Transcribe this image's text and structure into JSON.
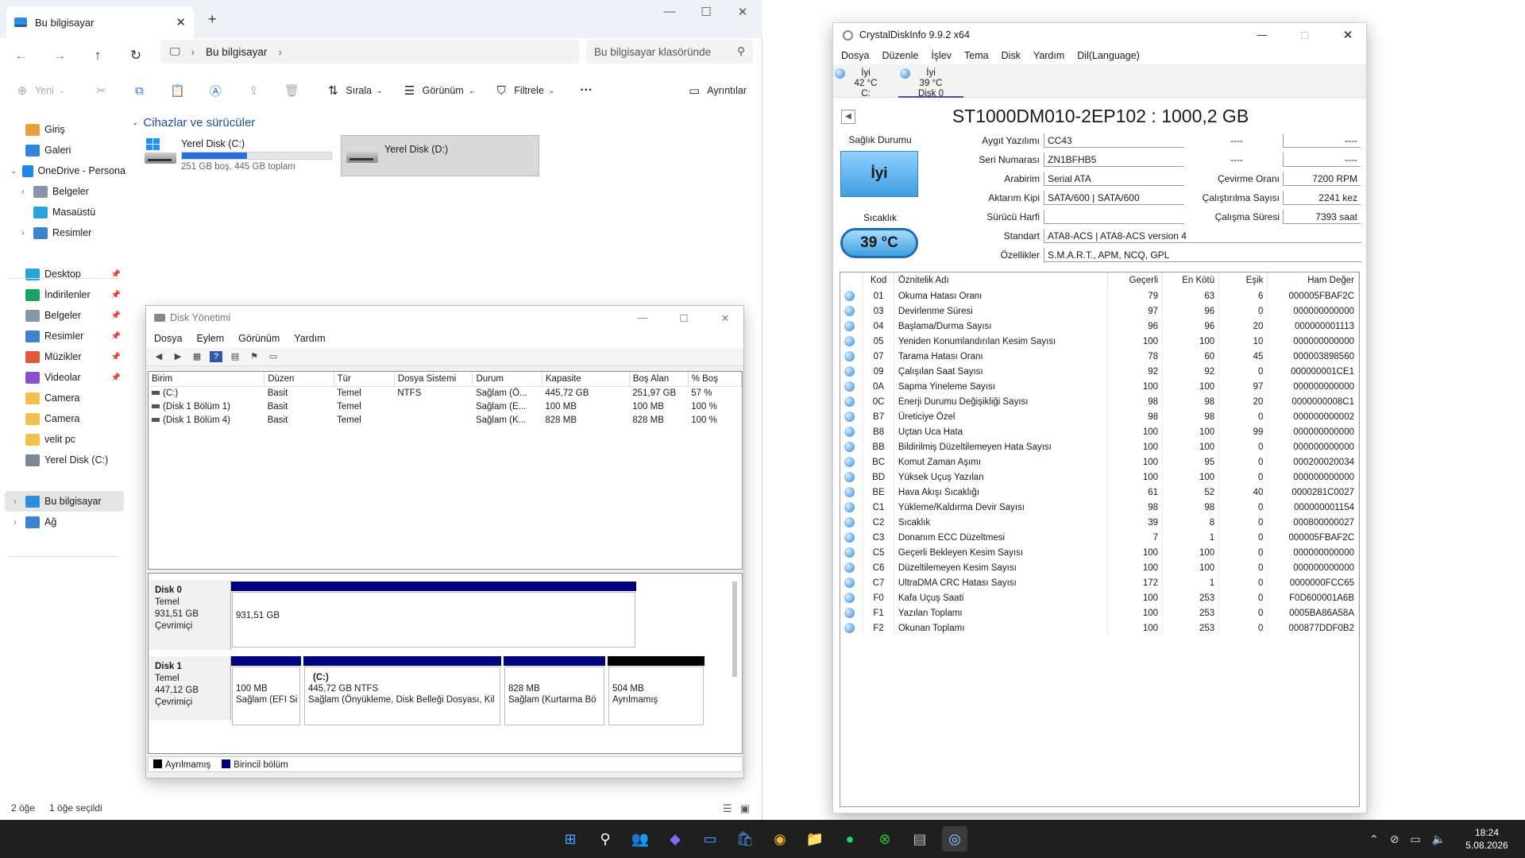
{
  "explorer": {
    "tab_title": "Bu bilgisayar",
    "address_crumb": "Bu bilgisayar",
    "search_placeholder": "Bu bilgisayar klasöründe",
    "toolbar": {
      "new": "Yeni",
      "sort": "Sırala",
      "view": "Görünüm",
      "filter": "Filtrele",
      "more": "···",
      "details": "Ayrıntılar"
    },
    "sidebar": [
      {
        "label": "Giriş",
        "icon": "home-icon"
      },
      {
        "label": "Galeri",
        "icon": "gallery-icon"
      },
      {
        "label": "OneDrive - Persona",
        "icon": "cloud-icon"
      },
      {
        "label": "Belgeler",
        "icon": "documents-icon"
      },
      {
        "label": "Masaüstü",
        "icon": "desktop-icon"
      },
      {
        "label": "Resimler",
        "icon": "pictures-icon"
      },
      {
        "label": "Desktop",
        "icon": "desktop-icon"
      },
      {
        "label": "İndirilenler",
        "icon": "download-icon"
      },
      {
        "label": "Belgeler",
        "icon": "documents-icon"
      },
      {
        "label": "Resimler",
        "icon": "pictures-icon"
      },
      {
        "label": "Müzikler",
        "icon": "music-icon"
      },
      {
        "label": "Videolar",
        "icon": "video-icon"
      },
      {
        "label": "Camera",
        "icon": "folder-icon"
      },
      {
        "label": "Camera",
        "icon": "folder-icon"
      },
      {
        "label": "velit pc",
        "icon": "folder-icon"
      },
      {
        "label": "Yerel Disk (C:)",
        "icon": "drive-icon"
      },
      {
        "label": "Bu bilgisayar",
        "icon": "computer-icon"
      },
      {
        "label": "Ağ",
        "icon": "network-icon"
      }
    ],
    "section_title": "Cihazlar ve sürücüler",
    "drives": [
      {
        "name": "Yerel Disk (C:)",
        "info": "251 GB boş, 445 GB toplam",
        "used_fraction": 0.436
      },
      {
        "name": "Yerel Disk (D:)",
        "info": "",
        "used_fraction": null
      }
    ],
    "status": {
      "items": "2 öğe",
      "selected": "1 öğe seçildi"
    }
  },
  "disk_management": {
    "title": "Disk Yönetimi",
    "menu": [
      "Dosya",
      "Eylem",
      "Görünüm",
      "Yardım"
    ],
    "columns": [
      "Birim",
      "Düzen",
      "Tür",
      "Dosya Sistemi",
      "Durum",
      "Kapasite",
      "Boş Alan",
      "% Boş"
    ],
    "volumes": [
      [
        "(C:)",
        "Basit",
        "Temel",
        "NTFS",
        "Sağlam (Ö...",
        "445,72 GB",
        "251,97 GB",
        "57 %"
      ],
      [
        "(Disk 1 Bölüm 1)",
        "Basit",
        "Temel",
        "",
        "Sağlam (E...",
        "100 MB",
        "100 MB",
        "100 %"
      ],
      [
        "(Disk 1 Bölüm 4)",
        "Basit",
        "Temel",
        "",
        "Sağlam (K...",
        "828 MB",
        "828 MB",
        "100 %"
      ]
    ],
    "disks": [
      {
        "name": "Disk 0",
        "type": "Temel",
        "size": "931,51 GB",
        "state": "Çevrimiçi",
        "partitions": [
          {
            "title": "",
            "size": "931,51 GB",
            "status": ""
          }
        ]
      },
      {
        "name": "Disk 1",
        "type": "Temel",
        "size": "447,12 GB",
        "state": "Çevrimiçi",
        "partitions": [
          {
            "title": "",
            "size": "100 MB",
            "status": "Sağlam (EFI Si"
          },
          {
            "title": "(C:)",
            "size": "445,72 GB NTFS",
            "status": "Sağlam (Önyükleme, Disk Belleği Dosyası, Kil"
          },
          {
            "title": "",
            "size": "828 MB",
            "status": "Sağlam (Kurtarma Bö"
          },
          {
            "title": "",
            "size": "504 MB",
            "status": "Ayrılmamış"
          }
        ]
      }
    ],
    "legend": {
      "unallocated": "Ayrılmamış",
      "primary": "Birincil bölüm"
    }
  },
  "crystaldiskinfo": {
    "title": "CrystalDiskInfo 9.9.2 x64",
    "menu": [
      "Dosya",
      "Düzenle",
      "İşlev",
      "Tema",
      "Disk",
      "Yardım",
      "Dil(Language)"
    ],
    "disk_tabs": [
      {
        "status": "İyi",
        "temp": "42 °C",
        "label": "C:"
      },
      {
        "status": "İyi",
        "temp": "39 °C",
        "label": "Disk 0"
      }
    ],
    "model": "ST1000DM010-2EP102 : 1000,2 GB",
    "health_label": "Sağlık Durumu",
    "health": "İyi",
    "temp_label": "Sıcaklık",
    "temp": "39 °C",
    "fields": {
      "firmware_label": "Aygıt Yazılımı",
      "firmware": "CC43",
      "serial_label": "Seri Numarası",
      "serial": "ZN1BFHB5",
      "interface_label": "Arabirim",
      "interface": "Serial ATA",
      "transfer_label": "Aktarım Kipi",
      "transfer": "SATA/600 | SATA/600",
      "drive_letter_label": "Sürücü Harfi",
      "drive_letter": "",
      "standard_label": "Standart",
      "standard": "ATA8-ACS | ATA8-ACS version 4",
      "features_label": "Özellikler",
      "features": "S.M.A.R.T., APM, NCQ, GPL",
      "dash": "----",
      "rotation_label": "Çevirme Oranı",
      "rotation": "7200 RPM",
      "power_count_label": "Çalıştırılma Sayısı",
      "power_count": "2241 kez",
      "power_hours_label": "Çalışma Süresi",
      "power_hours": "7393 saat"
    },
    "attr_columns": [
      "Kod",
      "Öznitelik Adı",
      "Geçerli",
      "En Kötü",
      "Eşik",
      "Ham Değer"
    ],
    "attributes": [
      [
        "01",
        "Okuma Hatası Oranı",
        "79",
        "63",
        "6",
        "000005FBAF2C"
      ],
      [
        "03",
        "Devirlenme Süresi",
        "97",
        "96",
        "0",
        "000000000000"
      ],
      [
        "04",
        "Başlama/Durma Sayısı",
        "96",
        "96",
        "20",
        "000000001113"
      ],
      [
        "05",
        "Yeniden Konumlandırılan Kesim Sayısı",
        "100",
        "100",
        "10",
        "000000000000"
      ],
      [
        "07",
        "Tarama Hatası Oranı",
        "78",
        "60",
        "45",
        "000003898560"
      ],
      [
        "09",
        "Çalışılan Saat Sayısı",
        "92",
        "92",
        "0",
        "000000001CE1"
      ],
      [
        "0A",
        "Sapma Yineleme Sayısı",
        "100",
        "100",
        "97",
        "000000000000"
      ],
      [
        "0C",
        "Enerji Durumu Değişikliği Sayısı",
        "98",
        "98",
        "20",
        "0000000008C1"
      ],
      [
        "B7",
        "Üreticiye Özel",
        "98",
        "98",
        "0",
        "000000000002"
      ],
      [
        "B8",
        "Uçtan Uca Hata",
        "100",
        "100",
        "99",
        "000000000000"
      ],
      [
        "BB",
        "Bildirilmiş Düzeltilemeyen Hata Sayısı",
        "100",
        "100",
        "0",
        "000000000000"
      ],
      [
        "BC",
        "Komut Zaman Aşımı",
        "100",
        "95",
        "0",
        "000200020034"
      ],
      [
        "BD",
        "Yüksek Uçuş Yazılan",
        "100",
        "100",
        "0",
        "000000000000"
      ],
      [
        "BE",
        "Hava Akışı Sıcaklığı",
        "61",
        "52",
        "40",
        "0000281C0027"
      ],
      [
        "C1",
        "Yükleme/Kaldırma Devir Sayısı",
        "98",
        "98",
        "0",
        "000000001154"
      ],
      [
        "C2",
        "Sıcaklık",
        "39",
        "8",
        "0",
        "000800000027"
      ],
      [
        "C3",
        "Donanım ECC Düzeltmesi",
        "7",
        "1",
        "0",
        "000005FBAF2C"
      ],
      [
        "C5",
        "Geçerli Bekleyen Kesim Sayısı",
        "100",
        "100",
        "0",
        "000000000000"
      ],
      [
        "C6",
        "Düzeltilemeyen Kesim Sayısı",
        "100",
        "100",
        "0",
        "000000000000"
      ],
      [
        "C7",
        "UltraDMA CRC Hatası Sayısı",
        "172",
        "1",
        "0",
        "0000000FCC65"
      ],
      [
        "F0",
        "Kafa Uçuş Saati",
        "100",
        "253",
        "0",
        "F0D600001A6B"
      ],
      [
        "F1",
        "Yazılan Toplamı",
        "100",
        "253",
        "0",
        "0005BA86A58A"
      ],
      [
        "F2",
        "Okunan Toplamı",
        "100",
        "253",
        "0",
        "000877DDF0B2"
      ]
    ]
  },
  "taskbar": {
    "apps": [
      "start-icon",
      "search-icon",
      "teams-icon",
      "copilot-icon",
      "desktop-app-icon",
      "store-icon",
      "chrome-icon",
      "explorer-icon",
      "spotify-icon",
      "xbox-icon",
      "installer-icon",
      "crystaldiskinfo-icon"
    ],
    "time": "18:24",
    "date": "5.08.2026"
  },
  "colors": {
    "primary_partition": "#00007f",
    "unallocated": "#000000",
    "health_good": "#3f9fe0",
    "accent": "#2670d8"
  }
}
